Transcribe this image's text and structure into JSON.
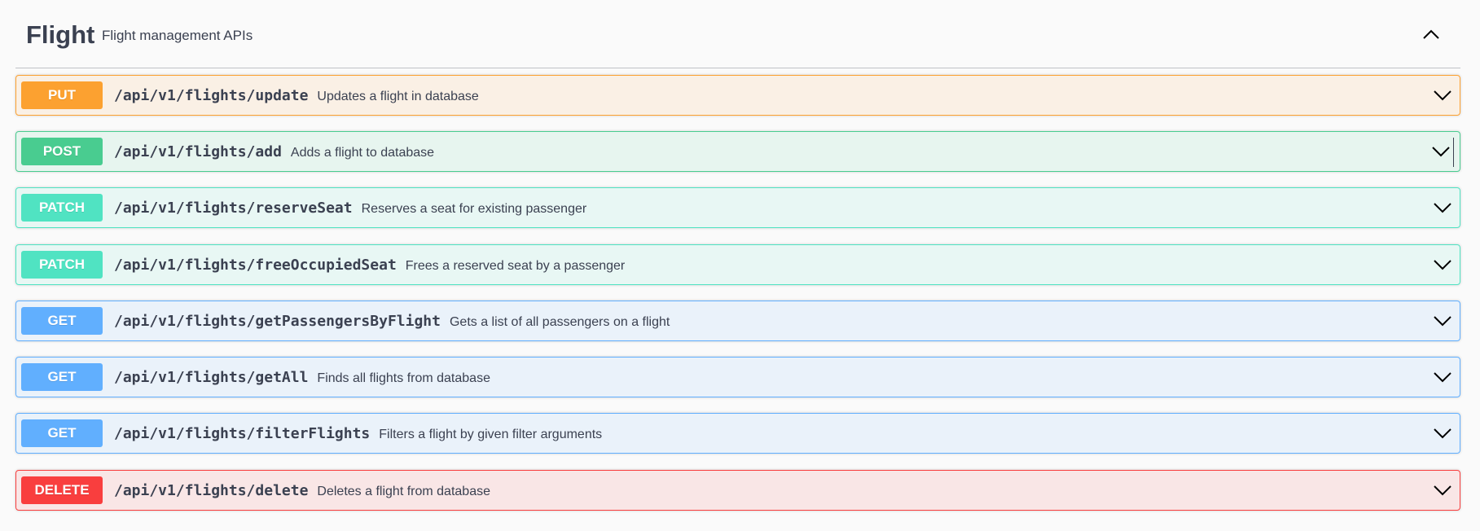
{
  "tag": {
    "name": "Flight",
    "description": "Flight management APIs",
    "toggle_icon": "chevron-up-icon"
  },
  "colors": {
    "put": "#fca130",
    "post": "#49cc90",
    "patch": "#50e3c2",
    "get": "#61affe",
    "delete": "#f93e3e",
    "text": "#3b4151"
  },
  "operations": [
    {
      "method": "PUT",
      "path": "/api/v1/flights/update",
      "summary": "Updates a flight in database"
    },
    {
      "method": "POST",
      "path": "/api/v1/flights/add",
      "summary": "Adds a flight to database"
    },
    {
      "method": "PATCH",
      "path": "/api/v1/flights/reserveSeat",
      "summary": "Reserves a seat for existing passenger"
    },
    {
      "method": "PATCH",
      "path": "/api/v1/flights/freeOccupiedSeat",
      "summary": "Frees a reserved seat by a passenger"
    },
    {
      "method": "GET",
      "path": "/api/v1/flights/getPassengersByFlight",
      "summary": "Gets a list of all passengers on a flight"
    },
    {
      "method": "GET",
      "path": "/api/v1/flights/getAll",
      "summary": "Finds all flights from database"
    },
    {
      "method": "GET",
      "path": "/api/v1/flights/filterFlights",
      "summary": "Filters a flight by given filter arguments"
    },
    {
      "method": "DELETE",
      "path": "/api/v1/flights/delete",
      "summary": "Deletes a flight from database"
    }
  ]
}
